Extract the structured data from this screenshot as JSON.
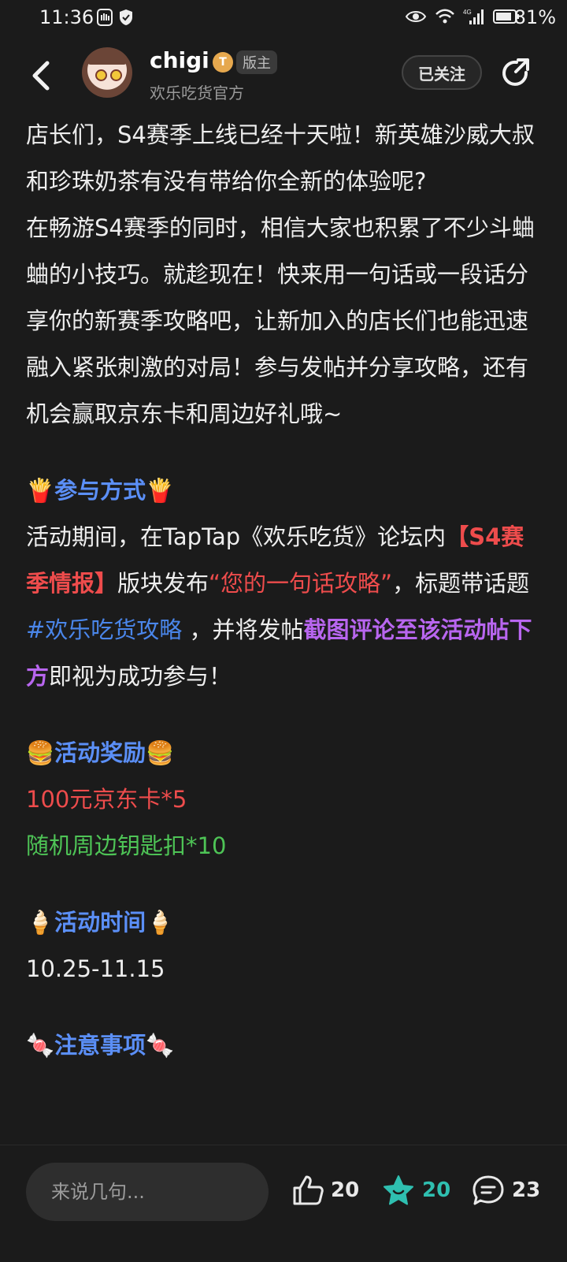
{
  "status_bar": {
    "time": "11:36",
    "network": "4G",
    "battery": "81%"
  },
  "header": {
    "username": "chigi",
    "level_badge": "T",
    "role": "版主",
    "forum": "欢乐吃货官方",
    "follow_label": "已关注"
  },
  "post": {
    "p1": "店长们，S4赛季上线已经十天啦！新英雄沙威大叔和珍珠奶茶有没有带给你全新的体验呢?",
    "p2": "在畅游S4赛季的同时，相信大家也积累了不少斗蛐蛐的小技巧。就趁现在！快来用一句话或一段话分享你的新赛季攻略吧，让新加入的店长们也能迅速融入紧张刺激的对局！参与发帖并分享攻略，还有机会赢取京东卡和周边好礼哦~",
    "participate": {
      "emoji": "🍟",
      "title": "参与方式",
      "t1": "活动期间，在TapTap《欢乐吃货》论坛内",
      "board": "【S4赛季情报】",
      "t2": "版块发布",
      "quote": "“您的一句话攻略”",
      "t3": "，标题带话题",
      "hashtag": "#欢乐吃货攻略",
      "t4": " ，并将发帖",
      "action": "截图评论至该活动帖下方",
      "t5": "即视为成功参与！"
    },
    "rewards": {
      "emoji": "🍔",
      "title": "活动奖励",
      "r1": "100元京东卡*5",
      "r2": "随机周边钥匙扣*10"
    },
    "time_section": {
      "emoji": "🍦",
      "title": "活动时间",
      "range": "10.25-11.15"
    },
    "notes": {
      "emoji": "🍬",
      "title": "注意事项"
    }
  },
  "bottom": {
    "comment_placeholder": "来说几句...",
    "likes": "20",
    "favorites": "20",
    "comments": "23"
  },
  "colors": {
    "background": "#1b1b1b",
    "section_blue": "#5b8ff7",
    "red": "#ee4c4c",
    "purple": "#b866ef",
    "green": "#4ec456",
    "teal": "#2fbfb0"
  }
}
